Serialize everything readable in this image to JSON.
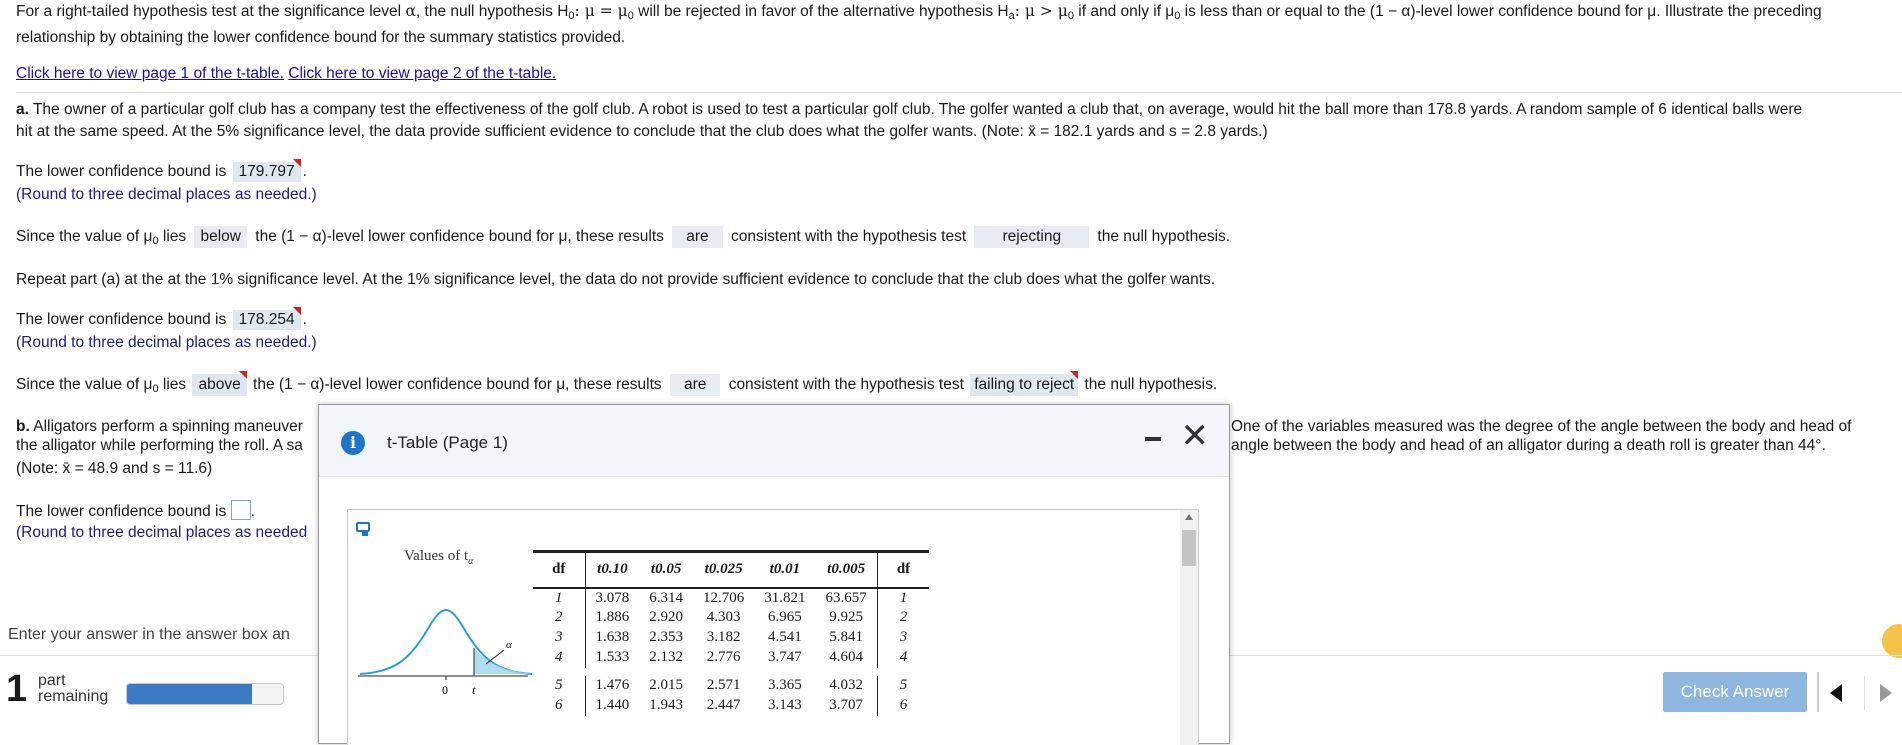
{
  "intro": {
    "line1_a": "For a right-tailed hypothesis test at the significance level ",
    "alpha": "α",
    "line1_b": ", the null hypothesis H",
    "sub0": "0",
    "line1_c": ": μ = μ",
    "line1_d": " will be rejected in favor of the alternative hypothesis H",
    "suba": "a",
    "line1_e": ": μ > μ",
    "line1_f": " if and only if μ",
    "line1_g": " is less than or equal to the (1 − α)-level lower confidence bound for μ. Illustrate the preceding",
    "line2": "relationship by obtaining the lower confidence bound for the summary statistics provided."
  },
  "links": {
    "page1": "Click here to view page 1 of the t-table.",
    "page2": "Click here to view page 2 of the t-table."
  },
  "part_a": {
    "label": "a.",
    "text1": "The owner of a particular golf club has a company test the effectiveness of the golf club. A robot is used to test a particular golf club. The golfer wanted a club that, on average, would hit the ball more than 178.8 yards. A random sample of 6 identical balls were",
    "text2": "hit at the same speed. At the 5% significance level, the data provide sufficient evidence to conclude that the club does what the golfer wants. (Note: x̄ = 182.1 yards and s = 2.8 yards.)",
    "lcb_prefix": "The lower confidence bound is",
    "lcb_value": "179.797",
    "round_note": "(Round to three decimal places as needed.)",
    "since_prefix": "Since the value of μ",
    "sub0": "0",
    "lies": "lies",
    "dropdown_position": "below",
    "since_mid": "the (1 − α)-level lower confidence bound for μ, these results",
    "dropdown_are": "are",
    "since_mid2": "consistent with the hypothesis test",
    "dropdown_decision": "rejecting",
    "since_end": "the null hypothesis.",
    "repeat": "Repeat part (a) at the at the 1% significance level. At the 1% significance level, the data do not provide sufficient evidence to conclude that the club does what the golfer wants.",
    "lcb2_value": "178.254",
    "dropdown_position2": "above",
    "dropdown_are2": "are",
    "dropdown_decision2": "failing to reject"
  },
  "part_b": {
    "label": "b.",
    "text1_left": "Alligators perform a spinning maneuver",
    "text1_right": "One of the variables measured was the degree of the angle between the body and head of",
    "text2_left": "the alligator while performing the roll. A sa",
    "text2_right": "angle between the body and head of an alligator during a death roll is greater than 44°.",
    "note": "(Note: x̄ = 48.9 and s = 11.6)",
    "lcb_prefix": "The lower confidence bound is",
    "round_note": "(Round to three decimal places as needed"
  },
  "footer": {
    "enter_answer": "Enter your answer in the answer box an",
    "part_count": "1",
    "part_word": "part",
    "remaining_word": "remaining",
    "progress": 0.8,
    "check_answer": "Check Answer"
  },
  "modal": {
    "title": "t-Table (Page 1)",
    "values_label": "Values of t",
    "values_sub": "α",
    "curve_zero": "0",
    "curve_t": "t",
    "curve_alpha": "α",
    "headers": [
      "df",
      "t0.10",
      "t0.05",
      "t0.025",
      "t0.01",
      "t0.005",
      "df"
    ],
    "rows": [
      [
        "1",
        "3.078",
        "6.314",
        "12.706",
        "31.821",
        "63.657",
        "1"
      ],
      [
        "2",
        "1.886",
        "2.920",
        "4.303",
        "6.965",
        "9.925",
        "2"
      ],
      [
        "3",
        "1.638",
        "2.353",
        "3.182",
        "4.541",
        "5.841",
        "3"
      ],
      [
        "4",
        "1.533",
        "2.132",
        "2.776",
        "3.747",
        "4.604",
        "4"
      ],
      [
        "5",
        "1.476",
        "2.015",
        "2.571",
        "3.365",
        "4.032",
        "5"
      ],
      [
        "6",
        "1.440",
        "1.943",
        "2.447",
        "3.143",
        "3.707",
        "6"
      ]
    ]
  },
  "colors": {
    "link": "#1a0dab",
    "answer_bg": "#dfe7f1",
    "check_button": "#8fb6de",
    "progress": "#3d7ac4",
    "info_icon": "#1f74c8",
    "flag": "#d42020"
  }
}
